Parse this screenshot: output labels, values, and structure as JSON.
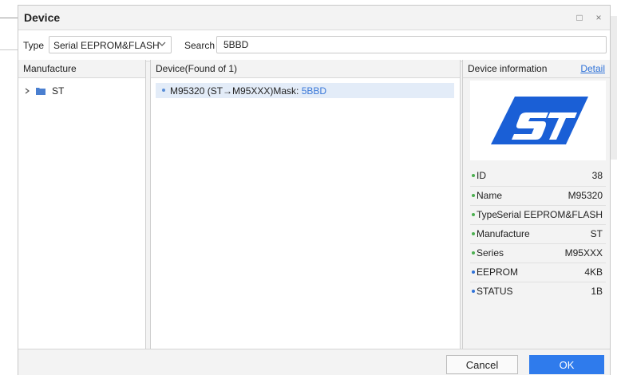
{
  "dialog": {
    "title": "Device"
  },
  "window_controls": {
    "maximize_glyph": "□",
    "close_glyph": "×"
  },
  "toolbar": {
    "type_label": "Type",
    "type_value": "Serial EEPROM&FLASH",
    "search_label": "Search",
    "search_value": "5BBD"
  },
  "manufacture_pane": {
    "header": "Manufacture",
    "items": [
      {
        "label": "ST",
        "icon": "folder-icon"
      }
    ]
  },
  "device_pane": {
    "header": "Device(Found of 1)",
    "items": [
      {
        "name": "M95320 (ST→M95XXX)Mask: ",
        "mask": "5BBD"
      }
    ]
  },
  "info_pane": {
    "header": "Device information",
    "detail_link": "Detail",
    "logo": "ST",
    "rows": [
      {
        "key": "ID",
        "value": "38",
        "dot": "#4caf50"
      },
      {
        "key": "Name",
        "value": "M95320",
        "dot": "#4caf50"
      },
      {
        "key": "Type",
        "value": "Serial EEPROM&FLASH",
        "dot": "#4caf50"
      },
      {
        "key": "Manufacture",
        "value": "ST",
        "dot": "#4caf50"
      },
      {
        "key": "Series",
        "value": "M95XXX",
        "dot": "#4caf50"
      },
      {
        "key": "EEPROM",
        "value": "4KB",
        "dot": "#2f72d8"
      },
      {
        "key": "STATUS",
        "value": "1B",
        "dot": "#2f72d8"
      }
    ]
  },
  "footer": {
    "cancel_label": "Cancel",
    "ok_label": "OK"
  },
  "colors": {
    "accent": "#2f7bec",
    "selected_row": "#e3ecf8",
    "logo_blue": "#1a5fd6"
  }
}
